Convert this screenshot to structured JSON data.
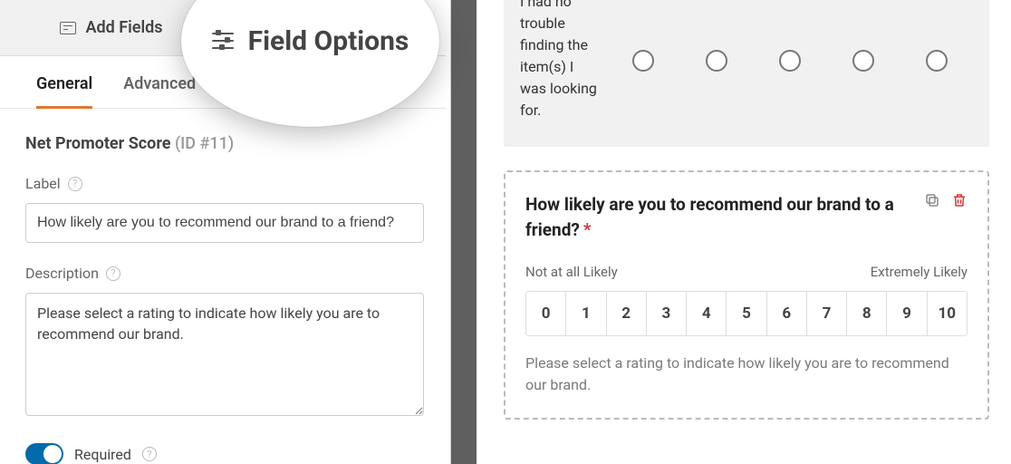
{
  "topTabs": {
    "addFields": "Add Fields",
    "fieldOptions": "Field Options"
  },
  "subTabs": {
    "general": "General",
    "advanced": "Advanced"
  },
  "field": {
    "title": "Net Promoter Score",
    "idLabel": "(ID #11)"
  },
  "labelGroup": {
    "caption": "Label",
    "value": "How likely are you to recommend our brand to a friend?"
  },
  "descriptionGroup": {
    "caption": "Description",
    "value": "Please select a rating to indicate how likely you are to recommend our brand."
  },
  "requiredToggle": {
    "label": "Required",
    "on": true
  },
  "preview": {
    "likert": {
      "rowLabel": "I had no trouble finding the item(s) I was looking for."
    },
    "nps": {
      "question": "How likely are you to recommend our brand to a friend?",
      "leftLabel": "Not at all Likely",
      "rightLabel": "Extremely Likely",
      "scale": [
        "0",
        "1",
        "2",
        "3",
        "4",
        "5",
        "6",
        "7",
        "8",
        "9",
        "10"
      ],
      "helper": "Please select a rating to indicate how likely you are to recommend our brand."
    }
  }
}
